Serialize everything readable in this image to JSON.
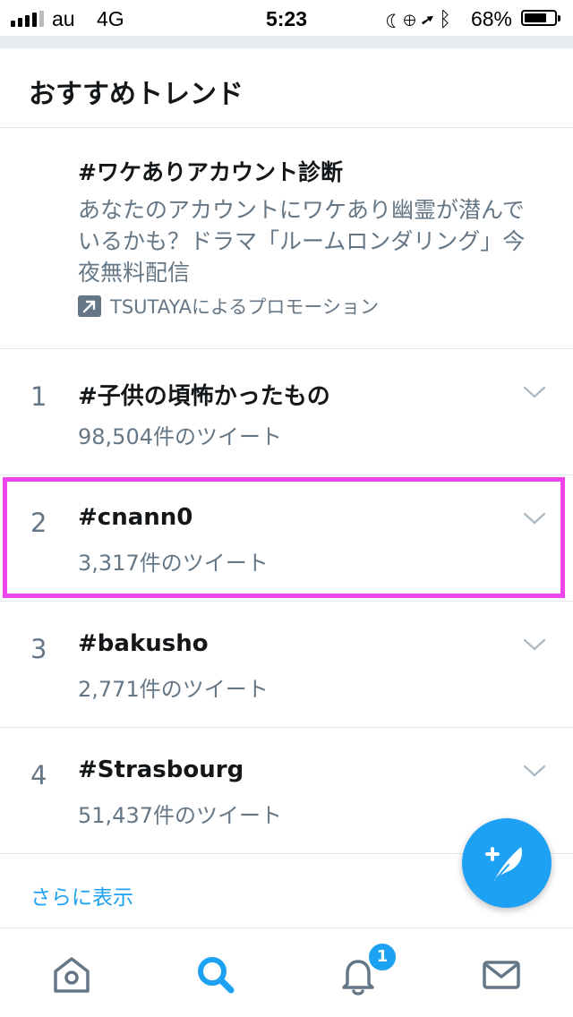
{
  "status_bar": {
    "carrier": "au",
    "network": "4G",
    "time": "5:23",
    "battery_percent": "68%",
    "battery_level": 0.68,
    "icons": [
      "moon-icon",
      "rotation-lock-icon",
      "location-icon",
      "bluetooth-icon"
    ]
  },
  "section": {
    "title": "おすすめトレンド"
  },
  "promoted": {
    "title": "#ワケありアカウント診断",
    "description": "あなたのアカウントにワケあり幽霊が潜んでいるかも？ドラマ「ルームロンダリング」今夜無料配信",
    "promo_label": "TSUTAYAによるプロモーション",
    "icon": "promoted-arrow-icon"
  },
  "trends": [
    {
      "rank": "1",
      "name": "#子供の頃怖かったもの",
      "count": "98,504件のツイート"
    },
    {
      "rank": "2",
      "name": "#cnann0",
      "count": "3,317件のツイート"
    },
    {
      "rank": "3",
      "name": "#bakusho",
      "count": "2,771件のツイート"
    },
    {
      "rank": "4",
      "name": "#Strasbourg",
      "count": "51,437件のツイート"
    }
  ],
  "show_more": "さらに表示",
  "tabbar": {
    "items": [
      "home-icon",
      "search-icon",
      "notifications-icon",
      "messages-icon"
    ],
    "active": "search-icon",
    "notification_badge": "1"
  },
  "colors": {
    "accent": "#1da1f2",
    "secondary_text": "#657786",
    "divider": "#e1e8ed",
    "highlight": "#ee44ee"
  }
}
